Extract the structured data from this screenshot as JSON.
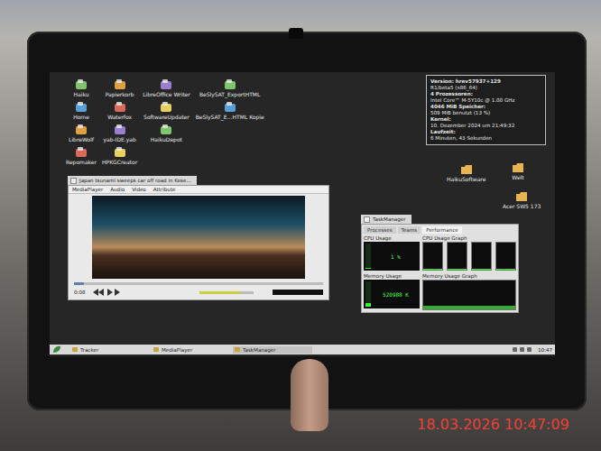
{
  "desktop": {
    "icon_columns": [
      {
        "icons": [
          {
            "label": "Haiku"
          },
          {
            "label": "Home"
          },
          {
            "label": "LibreWolf"
          },
          {
            "label": "Repomaker"
          }
        ]
      },
      {
        "icons": [
          {
            "label": "Papierkorb"
          },
          {
            "label": "Waterfox"
          },
          {
            "label": "yab-IDE.yab"
          },
          {
            "label": "HPKGCreator"
          }
        ]
      },
      {
        "icons": [
          {
            "label": "LibreOffice Writer"
          },
          {
            "label": "SoftwareUpdater"
          },
          {
            "label": "HaikuDepot"
          }
        ]
      },
      {
        "icons": [
          {
            "label": "BeSlySAT_ExportHTML"
          },
          {
            "label": "BeSlySAT_E…HTML Kopie"
          }
        ]
      }
    ],
    "right_icons": [
      {
        "label": "HaikuSoftware"
      },
      {
        "label": "Welt"
      },
      {
        "label": "Acer SW5 173"
      }
    ]
  },
  "system_info": {
    "lines": [
      {
        "text": "Version: hrev57937+129",
        "heading": true
      },
      {
        "text": "R1/beta5 (x86_64)",
        "heading": false
      },
      {
        "text": "4 Prozessoren:",
        "heading": true
      },
      {
        "text": "Intel Core™ M-5Y10c @ 1.00 GHz",
        "heading": false
      },
      {
        "text": "4046 MiB Speicher:",
        "heading": true
      },
      {
        "text": "509 MiB benutzt (13 %)",
        "heading": false
      },
      {
        "text": "Kernel:",
        "heading": true
      },
      {
        "text": "10. Dezember 2024 um 21:49:32",
        "heading": false
      },
      {
        "text": "Laufzeit:",
        "heading": true
      },
      {
        "text": "6 Minuten, 43 Sekunden",
        "heading": false
      }
    ]
  },
  "media_player": {
    "title": "Japan tsunami sweeps car off road in Kese…",
    "menu": [
      "MediaPlayer",
      "Audio",
      "Video",
      "Attribute"
    ],
    "position": "0:08",
    "progress": 0.04,
    "volume": 0.75
  },
  "task_manager": {
    "title": "TaskManager",
    "tabs": [
      {
        "label": "Processes",
        "selected": false
      },
      {
        "label": "Teams",
        "selected": false
      },
      {
        "label": "Performance",
        "selected": true
      }
    ],
    "cpu": {
      "label": "CPU Usage",
      "reading": "1 %",
      "level": 0.01
    },
    "cpu_graph": {
      "label": "CPU Usage Graph",
      "values": [
        2,
        1,
        3,
        1
      ]
    },
    "memory": {
      "label": "Memory Usage",
      "reading": "520988 K",
      "level": 0.13
    },
    "memory_graph": {
      "label": "Memory Usage Graph",
      "values": [
        13,
        13,
        13,
        13,
        13,
        13,
        13,
        13,
        13,
        13,
        13,
        13
      ]
    }
  },
  "deskbar": {
    "tasks": [
      {
        "label": "Tracker",
        "selected": false
      },
      {
        "label": "MediaPlayer",
        "selected": false
      },
      {
        "label": "TaskManager",
        "selected": true
      }
    ],
    "clock": "10:47"
  },
  "camera_timestamp": "18.03.2026 10:47:09"
}
